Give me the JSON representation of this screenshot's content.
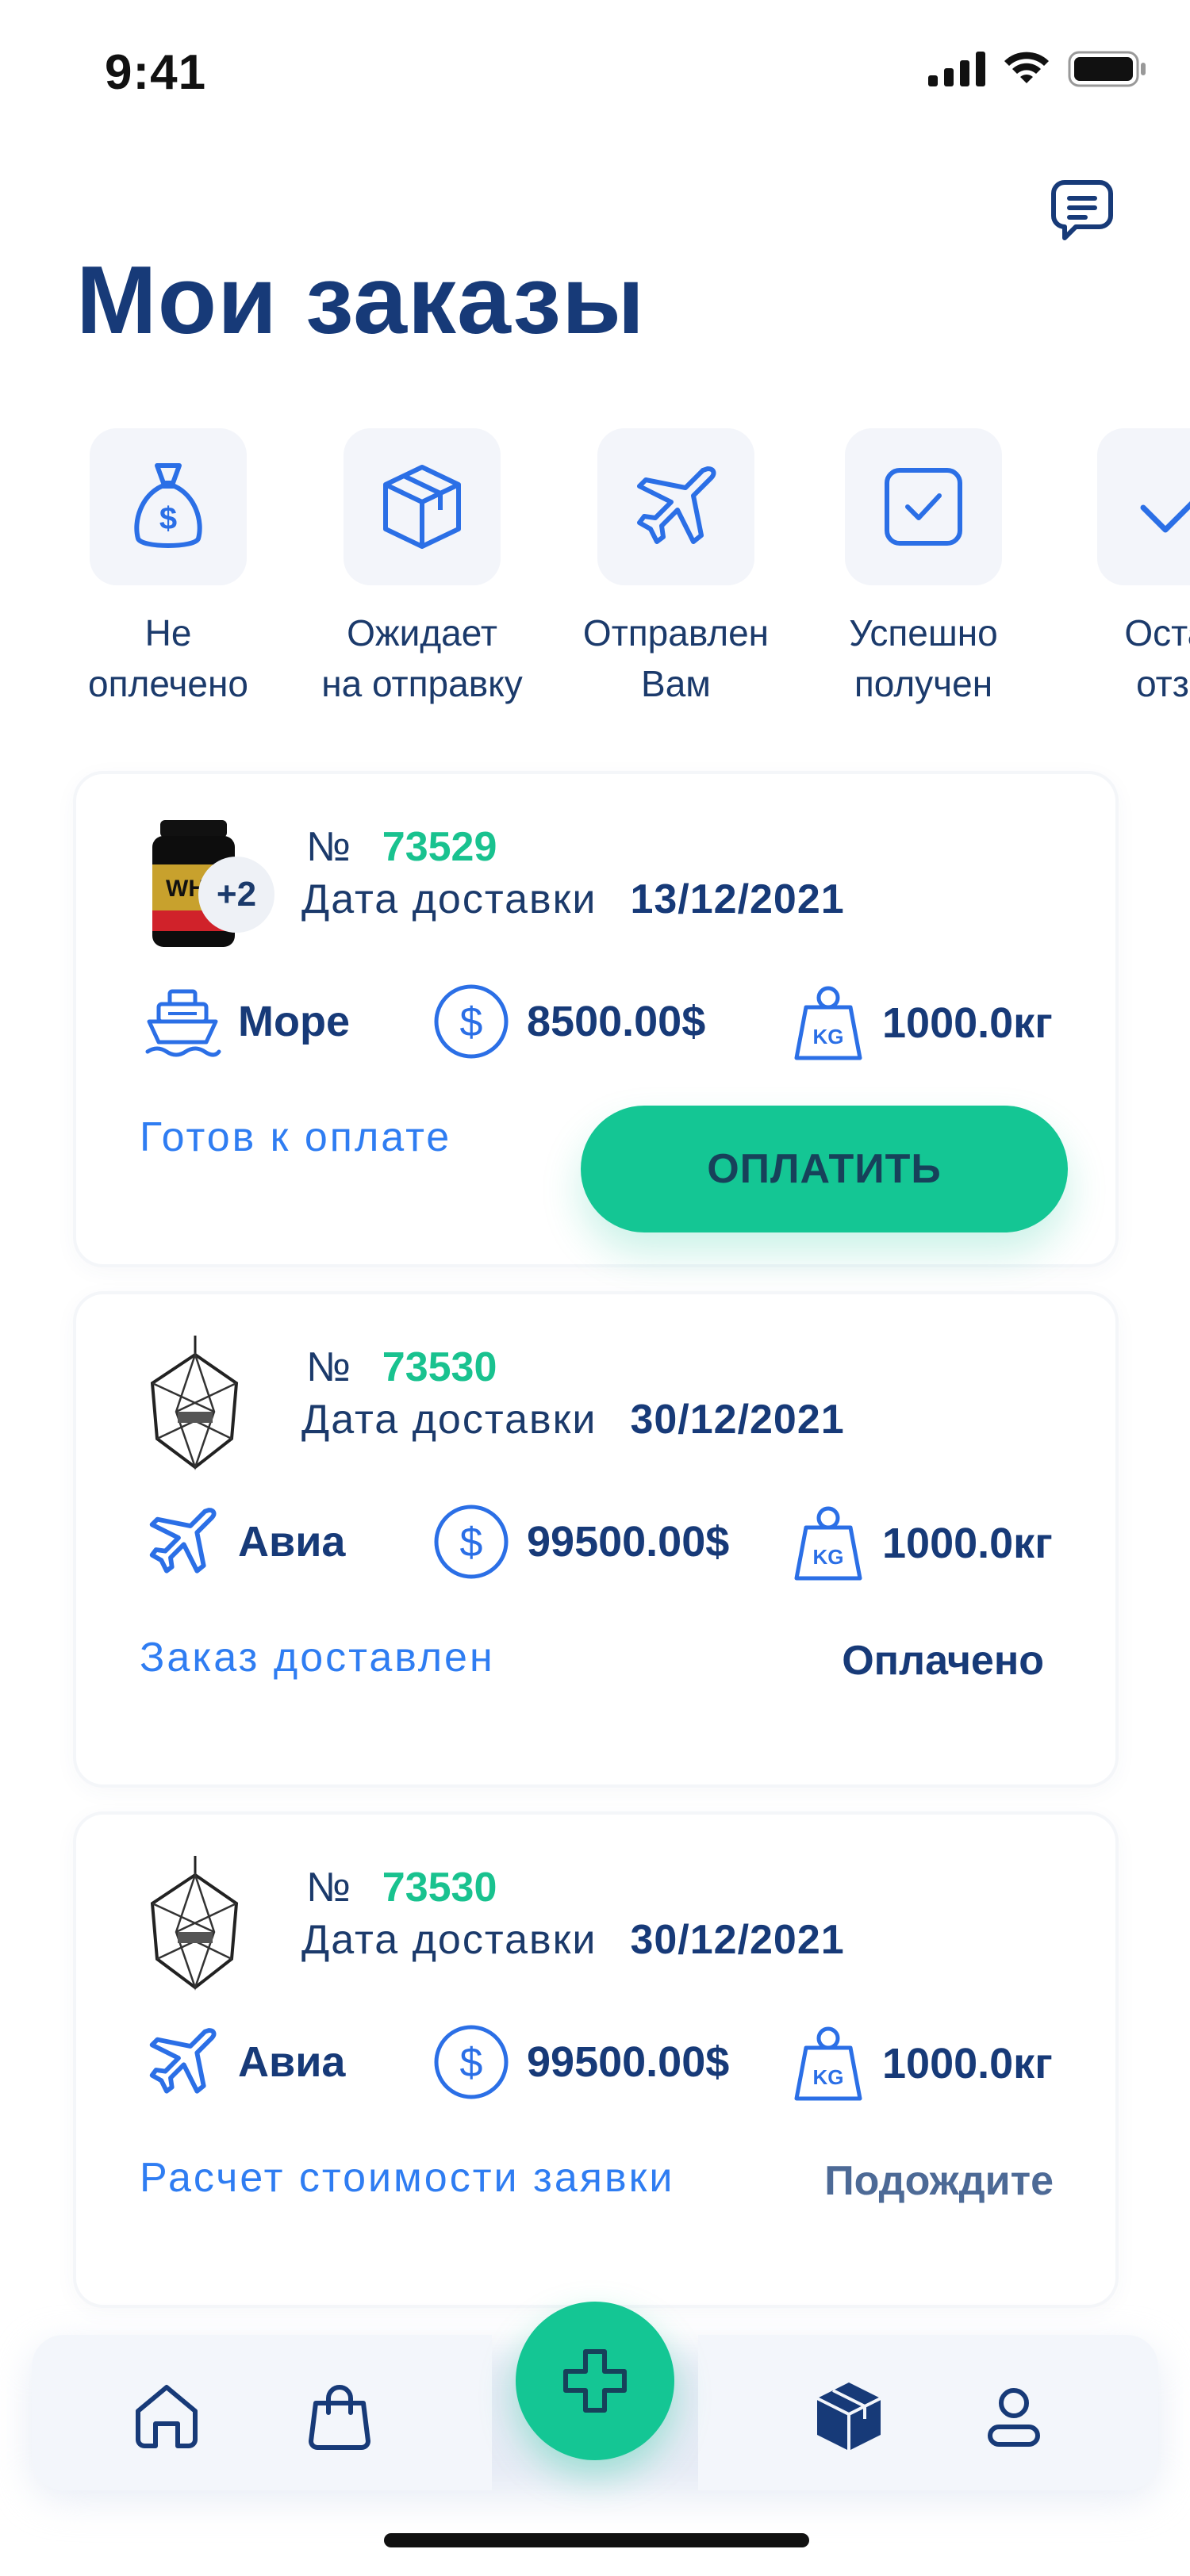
{
  "status_bar": {
    "time": "9:41"
  },
  "header": {
    "title": "Мои заказы"
  },
  "filters": [
    {
      "label": "Не\nоплечено",
      "icon": "money-bag-icon"
    },
    {
      "label": "Ожидает\nна отправку",
      "icon": "box-icon"
    },
    {
      "label": "Отправлен\nВам",
      "icon": "airplane-icon"
    },
    {
      "label": "Успешно\nполучен",
      "icon": "checkbox-icon"
    },
    {
      "label": "Остав\nотзы",
      "icon": "checkmark-icon"
    }
  ],
  "orders": [
    {
      "number_sign": "№",
      "number": "73529",
      "extra_count": "+2",
      "date_label": "Дата доставки",
      "date": "13/12/2021",
      "shipping": "Море",
      "price": "8500.00$",
      "weight": "1000.0кг",
      "weight_icon_text": "KG",
      "status": "Готов к оплате",
      "action_label": "ОПЛАТИТЬ"
    },
    {
      "number_sign": "№",
      "number": "73530",
      "date_label": "Дата доставки",
      "date": "30/12/2021",
      "shipping": "Авиа",
      "price": "99500.00$",
      "weight": "1000.0кг",
      "weight_icon_text": "KG",
      "status": "Заказ доставлен",
      "state": "Оплачено"
    },
    {
      "number_sign": "№",
      "number": "73530",
      "date_label": "Дата доставки",
      "date": "30/12/2021",
      "shipping": "Авиа",
      "price": "99500.00$",
      "weight": "1000.0кг",
      "weight_icon_text": "KG",
      "status": "Расчет стоимости заявки",
      "state": "Подождите"
    }
  ],
  "colors": {
    "primary": "#173a78",
    "accent_green": "#14c694",
    "link_blue": "#2f7df2",
    "icon_blue": "#2b6fe6"
  }
}
